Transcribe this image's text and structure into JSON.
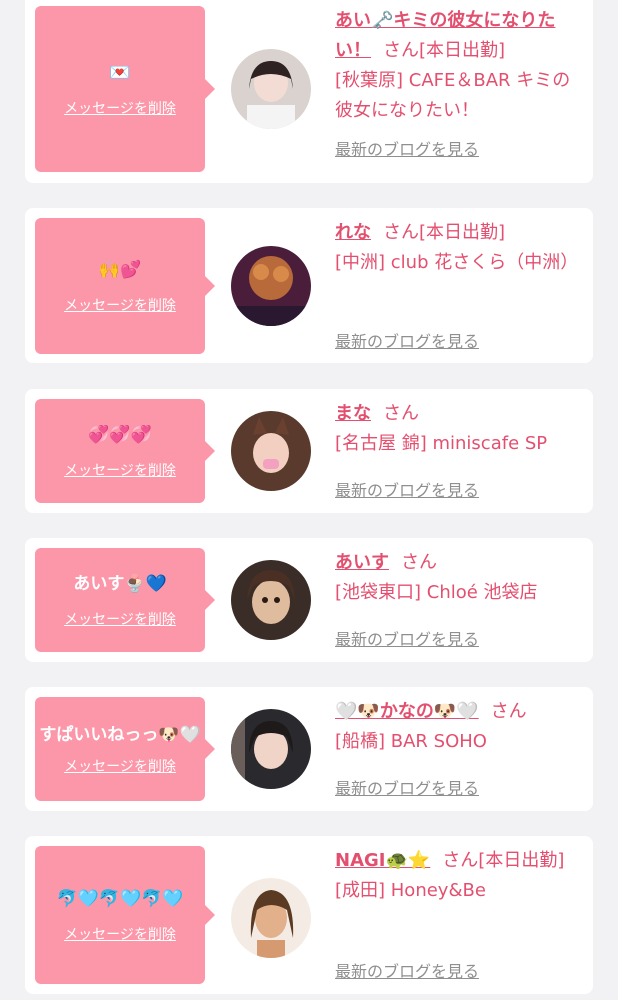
{
  "delete_label": "メッセージを削除",
  "blog_label": "最新のブログを見る",
  "san_label": "さん",
  "cards": [
    {
      "message": "💌",
      "name": "あい🗝️キミの彼女になりたい！",
      "status": "[本日出勤]",
      "shop": "[秋葉原] CAFE＆BAR キミの彼女になりたい！",
      "avatar_colors": [
        "#e8e1de",
        "#3a2a2a"
      ]
    },
    {
      "message": "🙌💕",
      "name": "れな",
      "status": "[本日出勤]",
      "shop": "[中洲] club 花さくら（中洲）",
      "avatar_colors": [
        "#7a2a4e",
        "#c0703a"
      ]
    },
    {
      "message": "💞💞💞",
      "name": "まな",
      "status": "",
      "shop": "[名古屋 錦] miniscafe SP",
      "avatar_colors": [
        "#6a4636",
        "#f0c8b8"
      ]
    },
    {
      "message": "あいす🍨💙",
      "name": "あいす",
      "status": "",
      "shop": "[池袋東口] Chloé 池袋店",
      "avatar_colors": [
        "#4a3a30",
        "#d8b89a"
      ]
    },
    {
      "message": "すぱいいねっっ🐶🤍",
      "name": "🤍🐶かなの🐶🤍",
      "status": "",
      "shop": "[船橋] BAR SOHO",
      "avatar_colors": [
        "#2a2a2a",
        "#f0d8d0"
      ]
    },
    {
      "message": "🐬🩵🐬🩵🐬🩵",
      "name": "NAGI🐢⭐",
      "status": "[本日出勤]",
      "shop": "[成田] Honey&Be",
      "avatar_colors": [
        "#b88a5a",
        "#3a2418"
      ]
    }
  ]
}
